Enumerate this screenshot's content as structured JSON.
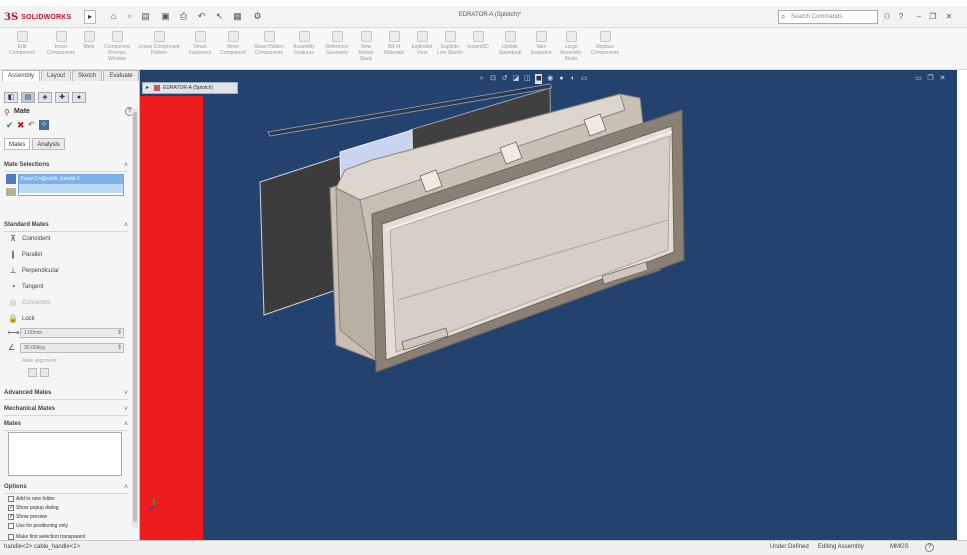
{
  "app": {
    "brand": "SOLIDWORKS",
    "brand_mark": "3S",
    "doc_title": "EDRATOR-A (Splotch)*",
    "search_placeholder": "Search Commands"
  },
  "titlebar": {
    "quick_access": [
      "home-icon",
      "new-icon",
      "open-icon",
      "save-icon",
      "print-icon",
      "undo-icon",
      "select-icon",
      "rebuild-icon",
      "options-icon"
    ],
    "right_icons": [
      "user-icon",
      "help-icon",
      "minimize-icon",
      "restore-icon",
      "close-icon"
    ]
  },
  "command_manager": {
    "items": [
      "Edit Component",
      "Insert Components",
      "Mate",
      "Component Preview Window",
      "Linear Component Pattern",
      "Smart Fasteners",
      "Move Component",
      "Show Hidden Components",
      "Assembly Features",
      "Reference Geometry",
      "New Motion Study",
      "Bill of Materials",
      "Exploded View",
      "Explode Line Sketch",
      "Instant3D",
      "Update Speedpak",
      "Take Snapshot",
      "Large Assembly Mode",
      "Replace Components"
    ]
  },
  "left_panel": {
    "tabs": [
      "Assembly",
      "Layout",
      "Sketch",
      "Evaluate"
    ],
    "active_tab": "Assembly",
    "feature_title": "Mate",
    "subtabs": [
      "Mates",
      "Analysis"
    ],
    "sections": {
      "mate_selections": "Mate Selections",
      "standard_mates": "Standard Mates",
      "advanced_mates": "Advanced Mates",
      "mechanical_mates": "Mechanical Mates",
      "mates": "Mates",
      "options": "Options"
    },
    "selections": [
      "Face<1>@cable_handle-1",
      ""
    ],
    "standard_mates": [
      {
        "label": "Coincident",
        "icon": "coincident-icon",
        "enabled": true
      },
      {
        "label": "Parallel",
        "icon": "parallel-icon",
        "enabled": true
      },
      {
        "label": "Perpendicular",
        "icon": "perpendicular-icon",
        "enabled": true
      },
      {
        "label": "Tangent",
        "icon": "tangent-icon",
        "enabled": true
      },
      {
        "label": "Concentric",
        "icon": "concentric-icon",
        "enabled": false
      },
      {
        "label": "Lock",
        "icon": "lock-icon",
        "enabled": true
      }
    ],
    "distance_value": "1.00mm",
    "angle_value": "30.00deg",
    "mate_alignment_label": "Mate alignment:",
    "options": [
      {
        "label": "Add to new folder",
        "checked": false
      },
      {
        "label": "Show popup dialog",
        "checked": true
      },
      {
        "label": "Show preview",
        "checked": true
      },
      {
        "label": "Use for positioning only",
        "checked": false
      },
      {
        "label": "Make first selection transparent",
        "checked": false
      }
    ]
  },
  "viewport": {
    "doc_tab": "EDRATOR-A (Splotch)",
    "background": "#24426e",
    "accent_red": "#ee1c1c",
    "hud_icons": [
      "zoom-fit-icon",
      "zoom-area-icon",
      "previous-view-icon",
      "section-view-icon",
      "view-orientation-icon",
      "display-style-icon",
      "hide-show-icon",
      "appearance-icon",
      "scene-icon",
      "view-settings-icon"
    ],
    "selected_hud": "display-style-icon"
  },
  "status_bar": {
    "left": "handle<2> cable_handle<1>",
    "definition": "Under Defined",
    "editing": "Editing Assembly",
    "units": "MMGS"
  }
}
